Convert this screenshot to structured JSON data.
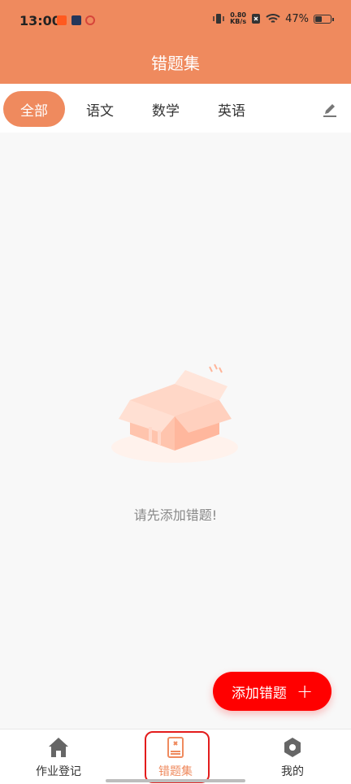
{
  "status_bar": {
    "time": "13:00",
    "network_speed_value": "0.80",
    "network_speed_unit": "KB/s",
    "battery_percent": "47%",
    "battery_level": 0.47
  },
  "header": {
    "title": "错题集"
  },
  "tabs": [
    {
      "label": "全部"
    },
    {
      "label": "语文"
    },
    {
      "label": "数学"
    },
    {
      "label": "英语"
    }
  ],
  "empty_state": {
    "message": "请先添加错题!"
  },
  "fab": {
    "label": "添加错题",
    "plus": "+"
  },
  "bottom_nav": [
    {
      "label": "作业登记",
      "icon": "home-icon"
    },
    {
      "label": "错题集",
      "icon": "wrong-book-icon"
    },
    {
      "label": "我的",
      "icon": "hexagon-profile-icon"
    }
  ],
  "colors": {
    "accent": "#ef8a5e",
    "fab": "#ff0000",
    "highlight_box": "#e31c1c"
  }
}
